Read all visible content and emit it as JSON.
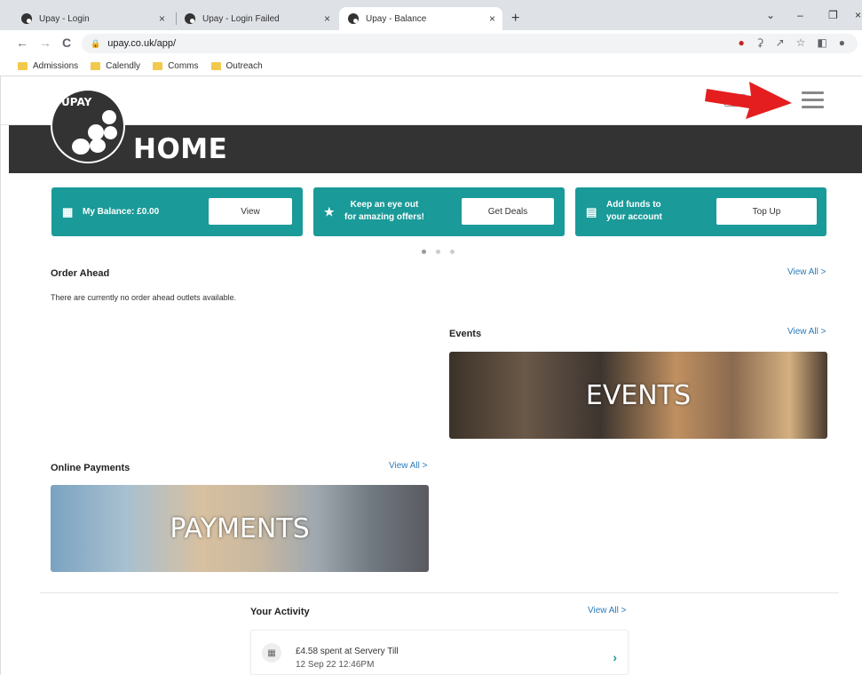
{
  "browser": {
    "tabs": [
      {
        "title": "Upay - Login",
        "close": "×"
      },
      {
        "title": "Upay - Login Failed",
        "close": "×"
      },
      {
        "title": "Upay - Balance",
        "close": "×"
      }
    ],
    "new_tab": "+",
    "window_controls": {
      "chevron": "⌄",
      "minimize": "–",
      "restore": "❐",
      "close": "×"
    },
    "nav": {
      "back": "←",
      "forward": "→",
      "reload": "C"
    },
    "url": "upay.co.uk/app/",
    "bookmarks": [
      "Admissions",
      "Calendly",
      "Comms",
      "Outreach"
    ]
  },
  "header": {
    "logo_text": "UPAY",
    "title": "HOME"
  },
  "cards": [
    {
      "icon": "qr-code-icon",
      "label": "My Balance: £0.00",
      "button": "View"
    },
    {
      "icon": "star-icon",
      "label_line1": "Keep an eye out",
      "label_line2": "for amazing offers!",
      "button": "Get Deals"
    },
    {
      "icon": "wallet-icon",
      "label_line1": "Add funds to",
      "label_line2": "your account",
      "button": "Top Up"
    }
  ],
  "order_ahead": {
    "title": "Order Ahead",
    "view_all": "View All >",
    "empty_text": "There are currently no order ahead outlets available."
  },
  "events": {
    "title": "Events",
    "view_all": "View All >",
    "banner_label": "EVENTS"
  },
  "online_payments": {
    "title": "Online Payments",
    "view_all": "View All >",
    "banner_label": "PAYMENTS"
  },
  "activity": {
    "title": "Your Activity",
    "view_all": "View All >",
    "items": [
      {
        "line1": "£4.58 spent at Servery Till",
        "line2": "12 Sep 22 12:46PM",
        "chevron": "›"
      }
    ]
  },
  "colors": {
    "accent": "#1a9a98",
    "header_band": "#333333",
    "link": "#2b7bb9",
    "annotation_arrow": "#e41e1e"
  }
}
